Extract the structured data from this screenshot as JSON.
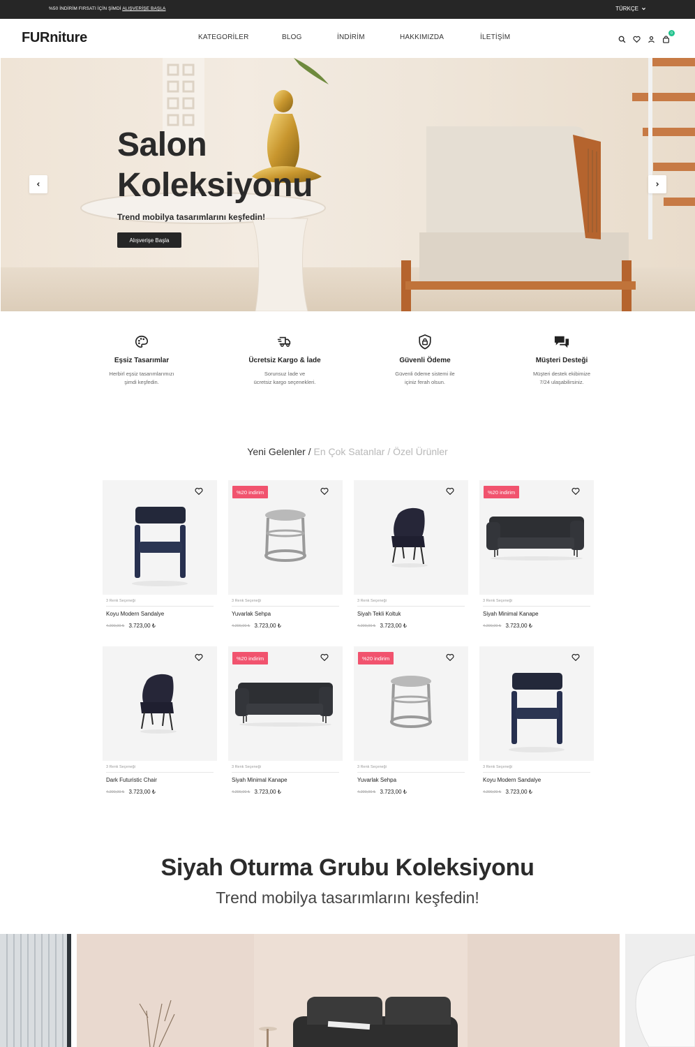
{
  "topbar": {
    "promo_prefix": "%50 İNDİRİM FIRSATI İÇİN ŞİMDİ ",
    "promo_link": "ALIŞVERİŞE BAŞLA",
    "language": "TÜRKÇE"
  },
  "header": {
    "logo": "FURniture",
    "nav": [
      "KATEGORİLER",
      "BLOG",
      "İNDİRİM",
      "HAKKIMIZDA",
      "İLETİŞİM"
    ],
    "cart_count": "0"
  },
  "hero": {
    "title_line1": "Salon",
    "title_line2": "Koleksiyonu",
    "subtitle": "Trend mobilya tasarımlarını keşfedin!",
    "cta": "Alışverişe Başla"
  },
  "features": [
    {
      "title": "Eşsiz Tasarımlar",
      "desc1": "Herbirl eşsiz tasarımlarımızı",
      "desc2": "şimdi keşfedin.",
      "icon": "palette-icon"
    },
    {
      "title": "Ücretsiz Kargo & İade",
      "desc1": "Sorunsuz İade ve",
      "desc2": "ücretsiz kargo seçenekleri.",
      "icon": "truck-icon"
    },
    {
      "title": "Güvenli Ödeme",
      "desc1": "Güvenli ödeme sistemi ile",
      "desc2": "içiniz ferah olsun.",
      "icon": "shield-lock-icon"
    },
    {
      "title": "Müşteri Desteği",
      "desc1": "Müşteri destek ekibimize",
      "desc2": "7/24 ulaşabilirsiniz.",
      "icon": "chat-icon"
    }
  ],
  "tabs": {
    "active": "Yeni Gelenler",
    "sep1": " / ",
    "t2": "En Çok Satanlar",
    "sep2": " / ",
    "t3": "Özel Ürünler"
  },
  "products": [
    {
      "name": "Koyu Modern Sandalye",
      "colors": "3 Renk Seçeneği",
      "old_price": "4.200,00 ₺",
      "price": "3.723,00 ₺",
      "discount": "",
      "kind": "dining-chair"
    },
    {
      "name": "Yuvarlak Sehpa",
      "colors": "3 Renk Seçeneği",
      "old_price": "4.200,00 ₺",
      "price": "3.723,00 ₺",
      "discount": "%20 indirim",
      "kind": "stool"
    },
    {
      "name": "Siyah Tekli Koltuk",
      "colors": "3 Renk Seçeneği",
      "old_price": "4.200,00 ₺",
      "price": "3.723,00 ₺",
      "discount": "",
      "kind": "armchair"
    },
    {
      "name": "Siyah Minimal Kanape",
      "colors": "3 Renk Seçeneği",
      "old_price": "4.200,00 ₺",
      "price": "3.723,00 ₺",
      "discount": "%20 indirim",
      "kind": "sofa"
    },
    {
      "name": "Dark Futuristic Chair",
      "colors": "3 Renk Seçeneği",
      "old_price": "4.200,00 ₺",
      "price": "3.723,00 ₺",
      "discount": "",
      "kind": "armchair"
    },
    {
      "name": "Siyah Minimal Kanape",
      "colors": "3 Renk Seçeneği",
      "old_price": "4.200,00 ₺",
      "price": "3.723,00 ₺",
      "discount": "%20 indirim",
      "kind": "sofa"
    },
    {
      "name": "Yuvarlak Sehpa",
      "colors": "3 Renk Seçeneği",
      "old_price": "4.200,00 ₺",
      "price": "3.723,00 ₺",
      "discount": "%20 indirim",
      "kind": "stool"
    },
    {
      "name": "Koyu Modern Sandalye",
      "colors": "3 Renk Seçeneği",
      "old_price": "4.200,00 ₺",
      "price": "3.723,00 ₺",
      "discount": "",
      "kind": "dining-chair"
    }
  ],
  "collection": {
    "title": "Siyah Oturma Grubu Koleksiyonu",
    "subtitle": "Trend mobilya tasarımlarını keşfedin!"
  },
  "colors": {
    "dark": "#262626",
    "discount": "#f1536e",
    "badge": "#22c38e"
  }
}
